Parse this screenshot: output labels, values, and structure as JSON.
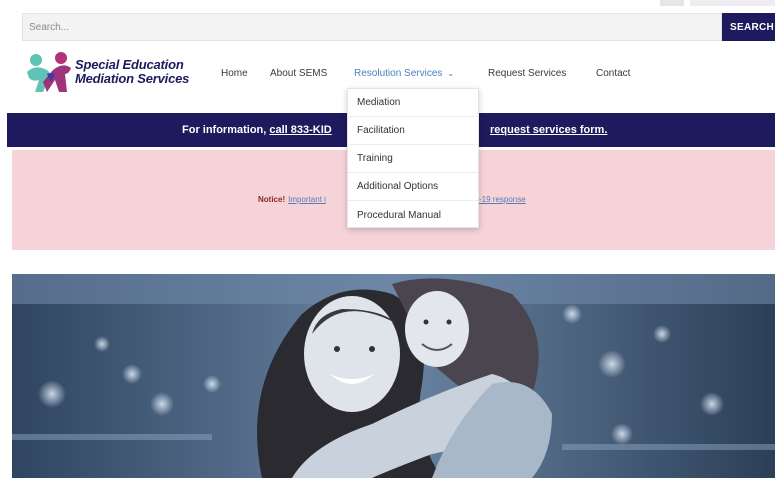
{
  "search": {
    "placeholder": "Search...",
    "button_label": "SEARCH"
  },
  "logo": {
    "line1": "Special Education",
    "line2": "Mediation Services"
  },
  "nav": {
    "items": [
      {
        "label": "Home"
      },
      {
        "label": "About SEMS"
      },
      {
        "label": "Resolution Services"
      },
      {
        "label": "Request Services"
      },
      {
        "label": "Contact"
      }
    ],
    "dropdown": [
      {
        "label": "Mediation"
      },
      {
        "label": "Facilitation"
      },
      {
        "label": "Training"
      },
      {
        "label": "Additional Options"
      },
      {
        "label": "Procedural Manual"
      }
    ]
  },
  "info_bar": {
    "prefix": "For information, ",
    "phone_link": "call 833-KID",
    "form_link": "request services form."
  },
  "notice": {
    "label": "Notice!",
    "link_start": "Important i",
    "link_end": "-19 response"
  },
  "colors": {
    "brand_navy": "#1e1a5e",
    "link_blue": "#4a7fc6",
    "notice_bg": "#f6d3d9"
  },
  "icons": {
    "logo": "two-people-embrace-logo",
    "chevron": "chevron-down-icon"
  }
}
